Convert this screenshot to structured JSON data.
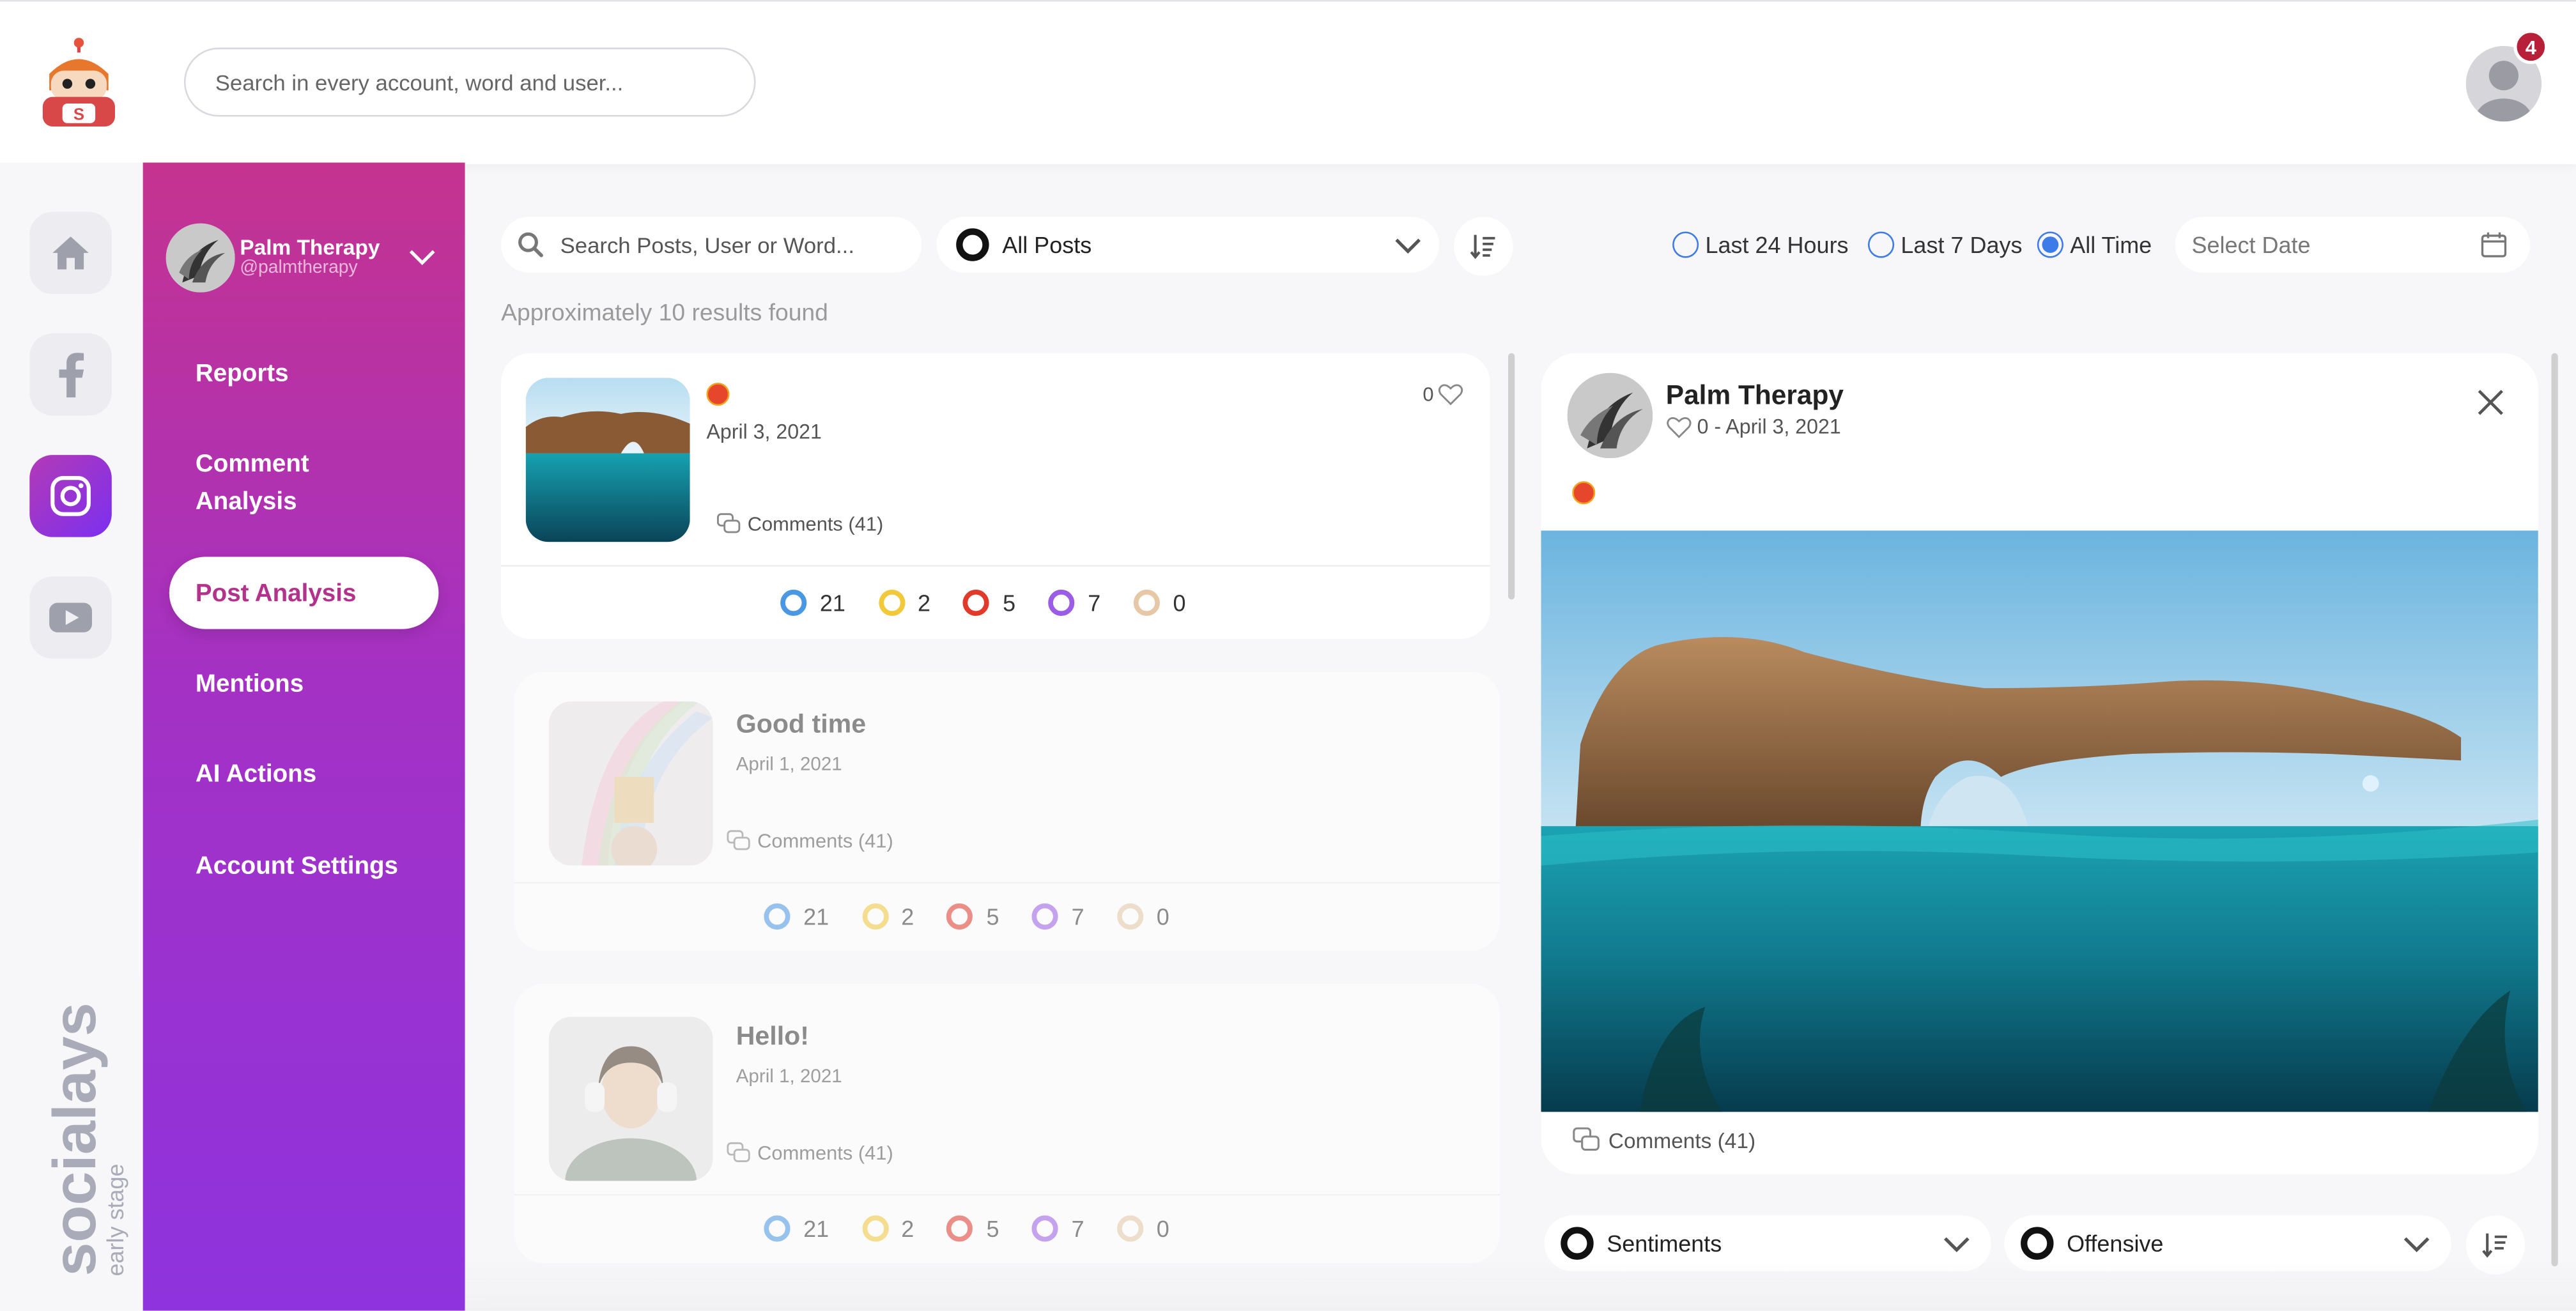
{
  "header": {
    "search_placeholder": "Search in every account, word and user...",
    "notification_count": "4"
  },
  "brand": {
    "name": "socialays",
    "tm": "™",
    "stage": "early stage"
  },
  "account": {
    "name": "Palm Therapy",
    "handle": "@palmtherapy"
  },
  "sidebar": {
    "items": [
      {
        "label": "Reports"
      },
      {
        "label": "Comment Analysis"
      },
      {
        "label": "Post Analysis"
      },
      {
        "label": "Mentions"
      },
      {
        "label": "AI Actions"
      },
      {
        "label": "Account Settings"
      }
    ]
  },
  "filters": {
    "post_search_placeholder": "Search Posts, User or Word...",
    "post_type": "All Posts",
    "ranges": [
      "Last 24 Hours",
      "Last 7 Days",
      "All Time"
    ],
    "selected_range": "All Time",
    "date_placeholder": "Select Date"
  },
  "results_text": "Approximately 10 results found",
  "sentiment_colors": [
    "#4a98e3",
    "#f2c93a",
    "#e23a2a",
    "#9b5de5",
    "#e6c8a6"
  ],
  "posts": [
    {
      "title": "",
      "date": "April 3, 2021",
      "comments": "Comments (41)",
      "likes": "0",
      "stats": [
        "21",
        "2",
        "5",
        "7",
        "0"
      ]
    },
    {
      "title": "Good time",
      "date": "April 1, 2021",
      "comments": "Comments (41)",
      "stats": [
        "21",
        "2",
        "5",
        "7",
        "0"
      ]
    },
    {
      "title": "Hello!",
      "date": "April 1, 2021",
      "comments": "Comments (41)",
      "stats": [
        "21",
        "2",
        "5",
        "7",
        "0"
      ]
    }
  ],
  "detail": {
    "account": "Palm Therapy",
    "meta": "0 - April 3, 2021",
    "comments": "Comments (41)",
    "filter1": "Sentiments",
    "filter2": "Offensive"
  }
}
